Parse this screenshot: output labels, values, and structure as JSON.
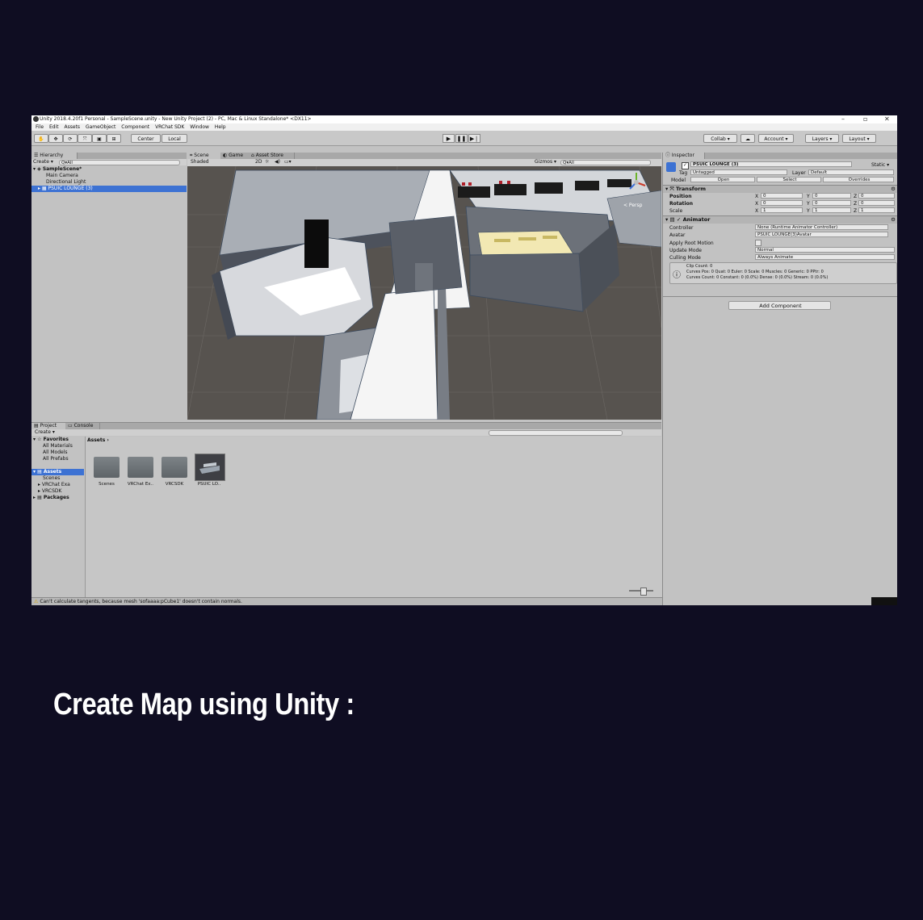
{
  "window": {
    "title": "Unity 2018.4.20f1 Personal - SampleScene.unity - New Unity Project (2) - PC, Mac & Linux Standalone* <DX11>",
    "controls": [
      "–",
      "▫",
      "✕"
    ]
  },
  "menu": [
    "File",
    "Edit",
    "Assets",
    "GameObject",
    "Component",
    "VRChat SDK",
    "Window",
    "Help"
  ],
  "toolbar": {
    "pivot": "Center",
    "space": "Local",
    "collab": "Collab ▾",
    "account": "Account ▾",
    "layers": "Layers ▾",
    "layout": "Layout ▾"
  },
  "hierarchy": {
    "tab": "Hierarchy",
    "create": "Create ▾",
    "search_placeholder": "Q▾All",
    "scene": "SampleScene*",
    "items": [
      "Main Camera",
      "Directional Light",
      "PSUIC LOUNGE (3)"
    ]
  },
  "scene_view": {
    "tabs": [
      "Scene",
      "Game",
      "Asset Store"
    ],
    "shading": "Shaded",
    "mode_2d": "2D",
    "gizmos": "Gizmos ▾",
    "search_placeholder": "Q▾All",
    "persp": "< Persp"
  },
  "inspector": {
    "tab": "Inspector",
    "object_name": "PSUIC LOUNGE (3)",
    "static_label": "Static ▾",
    "tag_label": "Tag",
    "tag_value": "Untagged",
    "layer_label": "Layer",
    "layer_value": "Default",
    "model_label": "Model",
    "model_buttons": [
      "Open",
      "Select",
      "Overrides"
    ],
    "transform": {
      "title": "Transform",
      "rows": [
        {
          "label": "Position",
          "x": "0",
          "y": "0",
          "z": "0"
        },
        {
          "label": "Rotation",
          "x": "0",
          "y": "0",
          "z": "0"
        },
        {
          "label": "Scale",
          "x": "1",
          "y": "1",
          "z": "1"
        }
      ]
    },
    "animator": {
      "title": "Animator",
      "controller_label": "Controller",
      "controller_value": "None (Runtime Animator Controller)",
      "avatar_label": "Avatar",
      "avatar_value": "PSUIC LOUNGE(3)Avatar",
      "root_motion_label": "Apply Root Motion",
      "update_mode_label": "Update Mode",
      "update_mode_value": "Normal",
      "culling_mode_label": "Culling Mode",
      "culling_mode_value": "Always Animate",
      "info_line1": "Clip Count: 0",
      "info_line2": "Curves Pos: 0 Quat: 0 Euler: 0 Scale: 0 Muscles: 0 Generic: 0 PPtr: 0",
      "info_line3": "Curves Count: 0 Constant: 0 (0.0%) Dense: 0 (0.0%) Stream: 0 (0.0%)"
    },
    "add_component": "Add Component"
  },
  "project": {
    "tabs": [
      "Project",
      "Console"
    ],
    "create": "Create ▾",
    "favorites_label": "Favorites",
    "favorites": [
      "All Materials",
      "All Models",
      "All Prefabs"
    ],
    "assets_label": "Assets",
    "asset_tree": [
      "Scenes",
      "VRChat Exa",
      "VRCSDK"
    ],
    "packages_label": "Packages",
    "breadcrumb": "Assets ›",
    "assets": [
      "Scenes",
      "VRChat Ex..",
      "VRCSDK",
      "PSUIC LO.."
    ]
  },
  "status": {
    "message": "Can't calculate tangents, because mesh 'sofaaaa:pCube1' doesn't contain normals."
  },
  "caption": "Create Map using Unity :"
}
